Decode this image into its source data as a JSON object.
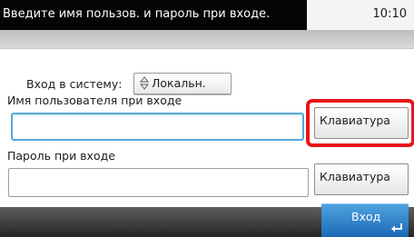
{
  "header": {
    "message": "Введите имя пользов. и пароль при входе.",
    "time": "10:10"
  },
  "login": {
    "label": "Вход в систему:",
    "selected": "Локальн."
  },
  "username": {
    "label": "Имя пользователя при входе",
    "value": "",
    "keyboard_label": "Клавиатура"
  },
  "password": {
    "label": "Пароль при входе",
    "value": "",
    "keyboard_label": "Клавиатура"
  },
  "footer": {
    "enter_label": "Вход"
  },
  "colors": {
    "highlight": "#e81519",
    "enter_button": "#2b7fca",
    "focus_border": "#55a8d8"
  }
}
